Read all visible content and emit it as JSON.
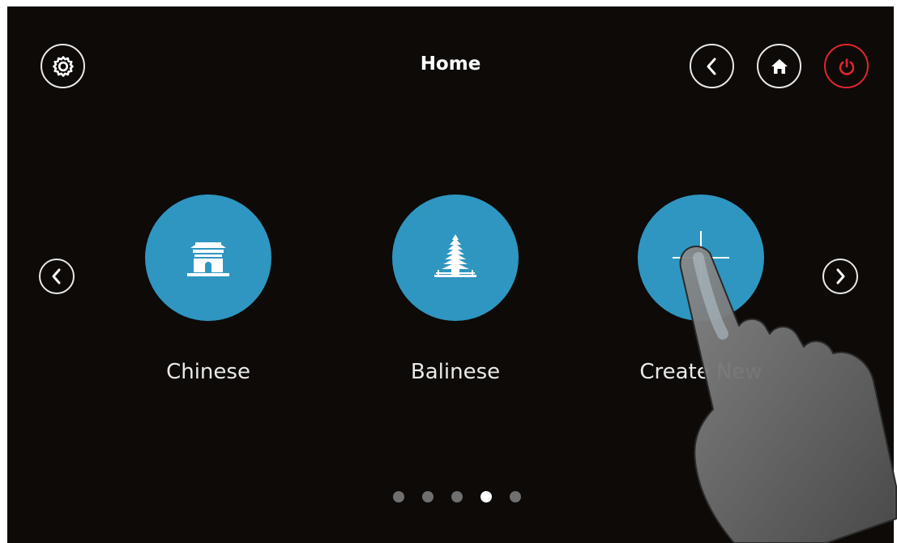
{
  "header": {
    "title": "Home",
    "buttons": {
      "settings": "gear-icon",
      "back": "chevron-left-icon",
      "home": "home-icon",
      "power": "power-icon"
    },
    "power_color": "#e0252b"
  },
  "carousel": {
    "items": [
      {
        "label": "Chinese",
        "icon": "chinese-temple-icon"
      },
      {
        "label": "Balinese",
        "icon": "balinese-pagoda-icon"
      },
      {
        "label": "Create New",
        "icon": "plus-icon"
      }
    ],
    "tile_color": "#2e96c0",
    "pager": {
      "count": 5,
      "active_index": 3
    }
  }
}
